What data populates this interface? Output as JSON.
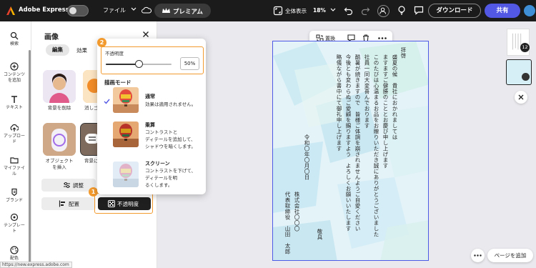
{
  "topbar": {
    "app_title": "Adobe Express",
    "file_menu": "ファイル",
    "premium": "プレミアム",
    "fit_label": "全体表示",
    "zoom": "18%",
    "download": "ダウンロード",
    "share": "共有"
  },
  "rail": {
    "items": [
      {
        "label": "検索",
        "icon": "search-icon"
      },
      {
        "label": "コンテンツ\nを追加",
        "icon": "add-icon"
      },
      {
        "label": "テキスト",
        "icon": "text-icon"
      },
      {
        "label": "アップロー\nド",
        "icon": "upload-icon"
      },
      {
        "label": "マイファイ\nル",
        "icon": "folder-icon"
      },
      {
        "label": "ブランド",
        "icon": "brand-icon"
      },
      {
        "label": "テンプレー\nト",
        "icon": "template-icon"
      },
      {
        "label": "配色",
        "icon": "palette-icon"
      }
    ]
  },
  "panel": {
    "title": "画像",
    "tabs": [
      "編集",
      "効果"
    ],
    "tools": [
      {
        "label": "背景を削除"
      },
      {
        "label": "消しゴ"
      },
      {
        "label": "オブジェクト\nを挿入"
      },
      {
        "label": "背景に"
      }
    ],
    "adjust": "調整",
    "arrange": "配置",
    "opacity": "不透明度",
    "step1": "1",
    "step2": "2"
  },
  "popup": {
    "opacity_label": "不透明度",
    "opacity_value": "50%",
    "opacity_level": 0.5,
    "blend_header": "描画モード",
    "modes": [
      {
        "title": "通常",
        "desc": "効果は適用されません。",
        "selected": true
      },
      {
        "title": "乗算",
        "desc": "コントラストと\nディテールを追加して、\nシャドウを暗くします。",
        "selected": false
      },
      {
        "title": "スクリーン",
        "desc": "コントラストを下げて、\nディテールを明\nるくします。",
        "selected": false
      }
    ]
  },
  "floating_toolbar": {
    "replace": "置換"
  },
  "letter": {
    "columns": [
      "拝啓",
      "盛夏の候　貴社におかれましては",
      "ますますご健勝のこととお慶び申し上げます",
      "このたびは心温まるお品をお贈りいただき誠にありがとうございました",
      "社員一同大変喜んでおります",
      "酷暑が続きますので　皆様ご体調を崩されませんようご自愛ください",
      "今後とも変わらぬご愛顧を賜りますよう　よろしくお願いいたします",
      "略儀ながら書中にて御礼申し上げます",
      "敬具",
      "令和〇年〇月〇日",
      "株式会社〇〇〇",
      "代表取締役　山田　太郎"
    ]
  },
  "right_rail": {
    "page1_badge": "12",
    "add_page": "ページを追加"
  },
  "status": {
    "url": "https://new.express.adobe.com"
  },
  "colors": {
    "accent": "#5258e4",
    "highlight": "#f29a2e",
    "topbar": "#1b1b1b",
    "selection": "#4d5ae5"
  }
}
